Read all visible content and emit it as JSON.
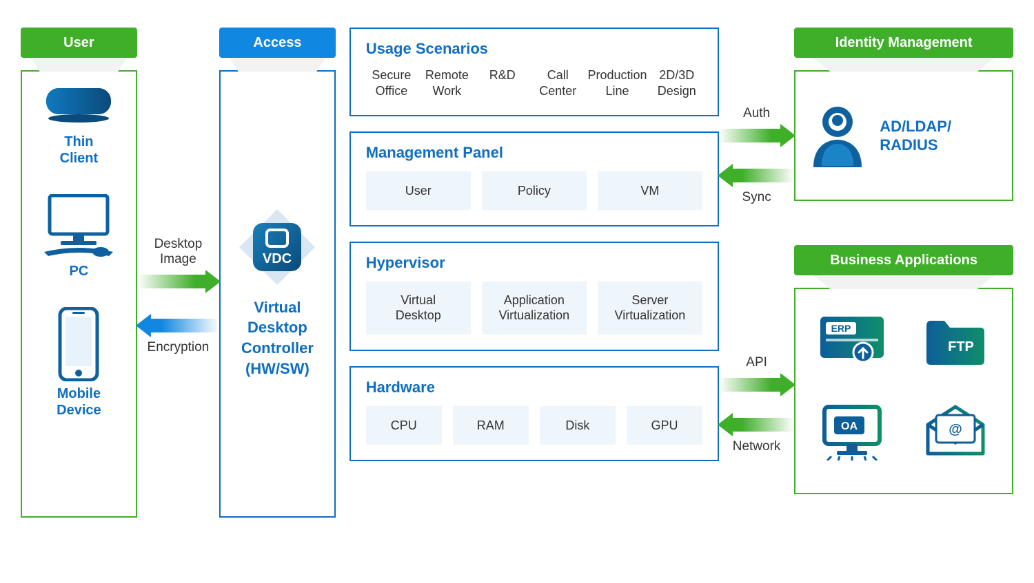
{
  "user": {
    "header": "User",
    "devices": [
      {
        "name": "thin-client",
        "label": "Thin\nClient"
      },
      {
        "name": "pc",
        "label": "PC"
      },
      {
        "name": "mobile",
        "label": "Mobile\nDevice"
      }
    ]
  },
  "transfer_user_access": {
    "to_access": "Desktop\nImage",
    "to_user": "Encryption"
  },
  "access": {
    "header": "Access",
    "vdc_badge": "VDC",
    "label": "Virtual\nDesktop\nController\n(HW/SW)"
  },
  "center": {
    "usage": {
      "title": "Usage Scenarios",
      "items": [
        "Secure\nOffice",
        "Remote\nWork",
        "R&D",
        "Call\nCenter",
        "Production\nLine",
        "2D/3D\nDesign"
      ]
    },
    "mgmt": {
      "title": "Management Panel",
      "tiles": [
        "User",
        "Policy",
        "VM"
      ]
    },
    "hypervisor": {
      "title": "Hypervisor",
      "tiles": [
        "Virtual\nDesktop",
        "Application\nVirtualization",
        "Server\nVirtualization"
      ]
    },
    "hardware": {
      "title": "Hardware",
      "tiles": [
        "CPU",
        "RAM",
        "Disk",
        "GPU"
      ]
    }
  },
  "transfer_center_right": {
    "auth": "Auth",
    "sync": "Sync",
    "api": "API",
    "network": "Network"
  },
  "identity": {
    "header": "Identity Management",
    "label": "AD/LDAP/\nRADIUS"
  },
  "business": {
    "header": "Business Applications",
    "apps": [
      "ERP",
      "FTP",
      "OA",
      "Mail"
    ]
  },
  "colors": {
    "green": "#3FAE29",
    "blue": "#0D6EC3"
  }
}
